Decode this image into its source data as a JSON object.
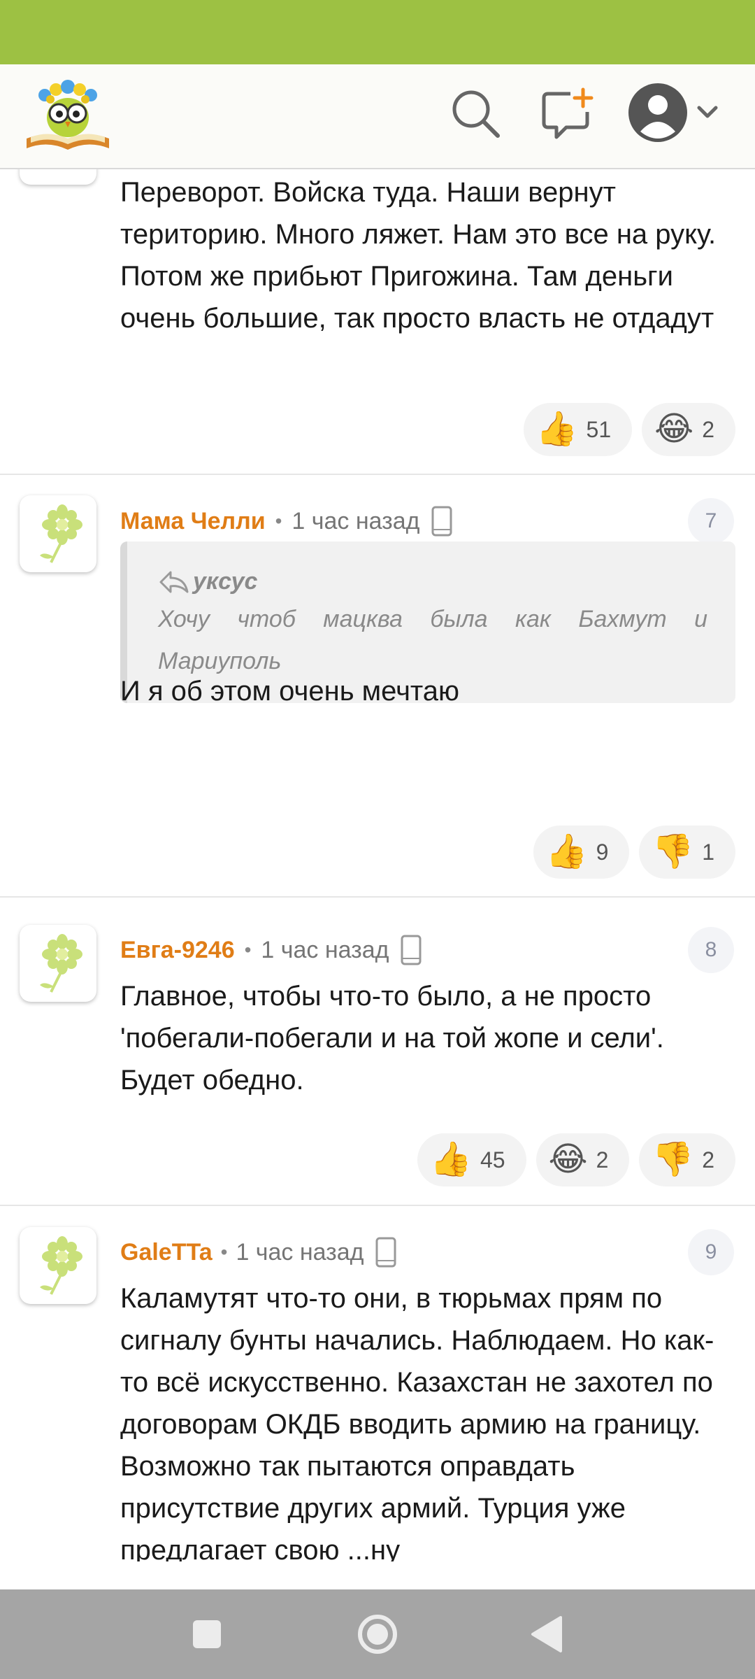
{
  "header": {
    "logo_icon": "owl-on-book-logo",
    "search_icon": "search-icon",
    "compose_icon": "new-comment-icon",
    "profile_icon": "user-avatar-icon"
  },
  "colors": {
    "status_bar": "#9dc143",
    "author": "#e07d16",
    "nav_bar": "#a5a5a5"
  },
  "comments": [
    {
      "text": "Переворот. Войска туда. Наши вернут територию. Много ляжет. Нам это все на руку. Потом же прибьют Пригожина. Там деньги очень большие, так просто власть не отдадут",
      "reactions": [
        {
          "emoji": "👍",
          "count": "51"
        },
        {
          "emoji": "😂",
          "count": "2"
        }
      ]
    },
    {
      "author": "Мама Челли",
      "time": "1 час назад",
      "number": "7",
      "quote": {
        "author": "уксус",
        "text": "Хочу чтоб мацква была как Бахмут и Мариуполь"
      },
      "text": "И я об этом очень мечтаю",
      "reactions": [
        {
          "emoji": "👍",
          "count": "9"
        },
        {
          "emoji": "👎",
          "count": "1"
        }
      ]
    },
    {
      "author": "Евга-9246",
      "time": "1 час назад",
      "number": "8",
      "text": "Главное, чтобы что-то было, а не просто 'побегали-побегали и на той жопе и сели'. Будет обедно.",
      "reactions": [
        {
          "emoji": "👍",
          "count": "45"
        },
        {
          "emoji": "😂",
          "count": "2"
        },
        {
          "emoji": "👎",
          "count": "2"
        }
      ]
    },
    {
      "author": "GaleTTa",
      "time": "1 час назад",
      "number": "9",
      "text": "Каламутят что-то они, в тюрьмах прям по сигналу бунты начались. Наблюдаем. Но как-то всё искусственно. Казахстан не захотел по договорам ОКДБ вводить армию на границу. Возможно так пытаются оправдать присутствие других армий. Турция уже предлагает свою ...ну"
    }
  ]
}
